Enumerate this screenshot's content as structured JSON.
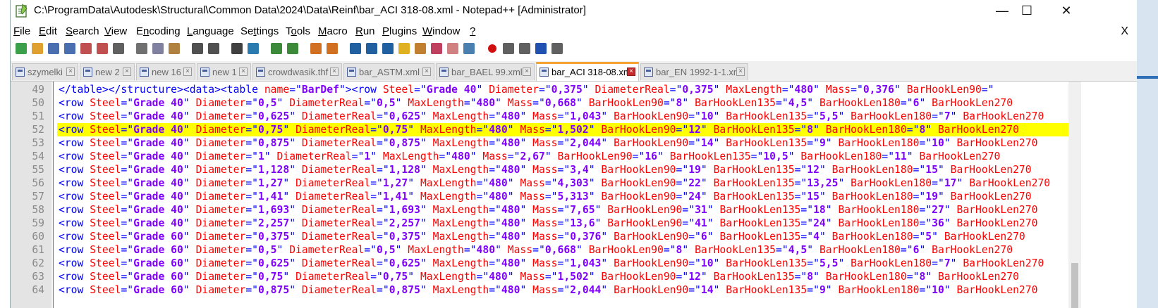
{
  "window": {
    "title": "C:\\ProgramData\\Autodesk\\Structural\\Common Data\\2024\\Data\\Reinf\\bar_ACI 318-08.xml - Notepad++ [Administrator]",
    "minimize_glyph": "—",
    "maximize_glyph": "☐",
    "close_glyph": "✕"
  },
  "menu": {
    "items": [
      {
        "label": "File",
        "u": "F",
        "rest": "ile"
      },
      {
        "label": "Edit",
        "u": "E",
        "rest": "dit"
      },
      {
        "label": "Search",
        "u": "S",
        "rest": "earch"
      },
      {
        "label": "View",
        "u": "V",
        "rest": "iew"
      },
      {
        "label": "Encoding",
        "u": "n",
        "pre": "E",
        "rest": "coding"
      },
      {
        "label": "Language",
        "u": "L",
        "rest": "anguage"
      },
      {
        "label": "Settings",
        "u": "t",
        "pre": "Se",
        "rest": "tings"
      },
      {
        "label": "Tools",
        "u": "o",
        "pre": "T",
        "rest": "ols"
      },
      {
        "label": "Macro",
        "u": "M",
        "rest": "acro"
      },
      {
        "label": "Run",
        "u": "R",
        "rest": "un"
      },
      {
        "label": "Plugins",
        "u": "P",
        "rest": "lugins"
      },
      {
        "label": "Window",
        "u": "W",
        "rest": "indow"
      },
      {
        "label": "?",
        "u": "?",
        "rest": ""
      }
    ],
    "close_label": "X"
  },
  "toolbar": {
    "buttons": [
      {
        "name": "new-file-icon",
        "color": "#3aa04a"
      },
      {
        "name": "open-file-icon",
        "color": "#e0a030"
      },
      {
        "name": "save-icon",
        "color": "#4a6fb0"
      },
      {
        "name": "save-all-icon",
        "color": "#4a6fb0"
      },
      {
        "name": "close-icon",
        "color": "#c05050"
      },
      {
        "name": "close-all-icon",
        "color": "#c05050"
      },
      {
        "name": "print-icon",
        "color": "#606060"
      },
      {
        "name": "cut-icon",
        "color": "#707070"
      },
      {
        "name": "copy-icon",
        "color": "#8080a0"
      },
      {
        "name": "paste-icon",
        "color": "#b08040"
      },
      {
        "name": "undo-icon",
        "color": "#505050"
      },
      {
        "name": "redo-icon",
        "color": "#505050"
      },
      {
        "name": "find-icon",
        "color": "#404040"
      },
      {
        "name": "replace-icon",
        "color": "#2a7ab0"
      },
      {
        "name": "zoom-in-icon",
        "color": "#3a8a3a"
      },
      {
        "name": "zoom-out-icon",
        "color": "#3a8a3a"
      },
      {
        "name": "sync-vertical-icon",
        "color": "#d07020"
      },
      {
        "name": "sync-horizontal-icon",
        "color": "#d07020"
      },
      {
        "name": "word-wrap-icon",
        "color": "#2060a0"
      },
      {
        "name": "show-all-chars-icon",
        "color": "#2060a0"
      },
      {
        "name": "indent-guide-icon",
        "color": "#2060a0"
      },
      {
        "name": "udl-icon",
        "color": "#e0b020"
      },
      {
        "name": "doc-map-icon",
        "color": "#c08030"
      },
      {
        "name": "function-list-icon",
        "color": "#c04060"
      },
      {
        "name": "folder-workspace-icon",
        "color": "#d08080"
      },
      {
        "name": "monitoring-icon",
        "color": "#4a80b0"
      },
      {
        "name": "record-macro-icon",
        "color": "#d01010"
      },
      {
        "name": "stop-macro-icon",
        "color": "#606060"
      },
      {
        "name": "play-macro-icon",
        "color": "#606060"
      },
      {
        "name": "run-macro-multiple-icon",
        "color": "#2050b0"
      },
      {
        "name": "save-macro-icon",
        "color": "#606060"
      }
    ]
  },
  "tabs": [
    {
      "label": "szymelki",
      "active": false
    },
    {
      "label": "new 2",
      "active": false
    },
    {
      "label": "new 16",
      "active": false
    },
    {
      "label": "new 1",
      "active": false
    },
    {
      "label": "crowdwasik.thf",
      "active": false
    },
    {
      "label": "bar_ASTM.xml",
      "active": false
    },
    {
      "label": "bar_BAEL 99.xml",
      "active": false
    },
    {
      "label": "bar_ACI 318-08.xml",
      "active": true
    },
    {
      "label": "bar_EN 1992-1-1.xml",
      "active": false
    }
  ],
  "editor": {
    "highlight_color": "#ffff00",
    "lines": [
      {
        "n": "49",
        "first": true,
        "steel": "Grade 40",
        "d": "0,375",
        "dr": "0,375",
        "ml": "480",
        "m": "0,376",
        "h90": "",
        "h135": "",
        "h180": ""
      },
      {
        "n": "50",
        "steel": "Grade 40",
        "d": "0,5",
        "dr": "0,5",
        "ml": "480",
        "m": "0,668",
        "h90": "8",
        "h135": "4,5",
        "h180": "6"
      },
      {
        "n": "51",
        "steel": "Grade 40",
        "d": "0,625",
        "dr": "0,625",
        "ml": "480",
        "m": "1,043",
        "h90": "10",
        "h135": "5,5",
        "h180": "7"
      },
      {
        "n": "52",
        "hl": true,
        "steel": "Grade 40",
        "d": "0,75",
        "dr": "0,75",
        "ml": "480",
        "m": "1,502",
        "h90": "12",
        "h135": "8",
        "h180": "8"
      },
      {
        "n": "53",
        "steel": "Grade 40",
        "d": "0,875",
        "dr": "0,875",
        "ml": "480",
        "m": "2,044",
        "h90": "14",
        "h135": "9",
        "h180": "10"
      },
      {
        "n": "54",
        "steel": "Grade 40",
        "d": "1",
        "dr": "1",
        "ml": "480",
        "m": "2,67",
        "h90": "16",
        "h135": "10,5",
        "h180": "11"
      },
      {
        "n": "55",
        "steel": "Grade 40",
        "d": "1,128",
        "dr": "1,128",
        "ml": "480",
        "m": "3,4",
        "h90": "19",
        "h135": "12",
        "h180": "15"
      },
      {
        "n": "56",
        "steel": "Grade 40",
        "d": "1,27",
        "dr": "1,27",
        "ml": "480",
        "m": "4,303",
        "h90": "22",
        "h135": "13,25",
        "h180": "17"
      },
      {
        "n": "57",
        "steel": "Grade 40",
        "d": "1,41",
        "dr": "1,41",
        "ml": "480",
        "m": "5,313",
        "h90": "24",
        "h135": "15",
        "h180": "19"
      },
      {
        "n": "58",
        "steel": "Grade 40",
        "d": "1,693",
        "dr": "1,693",
        "ml": "480",
        "m": "7,65",
        "h90": "31",
        "h135": "18",
        "h180": "27"
      },
      {
        "n": "59",
        "steel": "Grade 40",
        "d": "2,257",
        "dr": "2,257",
        "ml": "480",
        "m": "13,6",
        "h90": "41",
        "h135": "24",
        "h180": "36"
      },
      {
        "n": "60",
        "steel": "Grade 60",
        "d": "0,375",
        "dr": "0,375",
        "ml": "480",
        "m": "0,376",
        "h90": "6",
        "h135": "4",
        "h180": "5"
      },
      {
        "n": "61",
        "steel": "Grade 60",
        "d": "0,5",
        "dr": "0,5",
        "ml": "480",
        "m": "0,668",
        "h90": "8",
        "h135": "4,5",
        "h180": "6"
      },
      {
        "n": "62",
        "steel": "Grade 60",
        "d": "0,625",
        "dr": "0,625",
        "ml": "480",
        "m": "1,043",
        "h90": "10",
        "h135": "5,5",
        "h180": "7"
      },
      {
        "n": "63",
        "steel": "Grade 60",
        "d": "0,75",
        "dr": "0,75",
        "ml": "480",
        "m": "1,502",
        "h90": "12",
        "h135": "8",
        "h180": "8"
      },
      {
        "n": "64",
        "steel": "Grade 60",
        "d": "0,875",
        "dr": "0,875",
        "ml": "480",
        "m": "2,044",
        "h90": "14",
        "h135": "9",
        "h180": "10"
      }
    ]
  }
}
